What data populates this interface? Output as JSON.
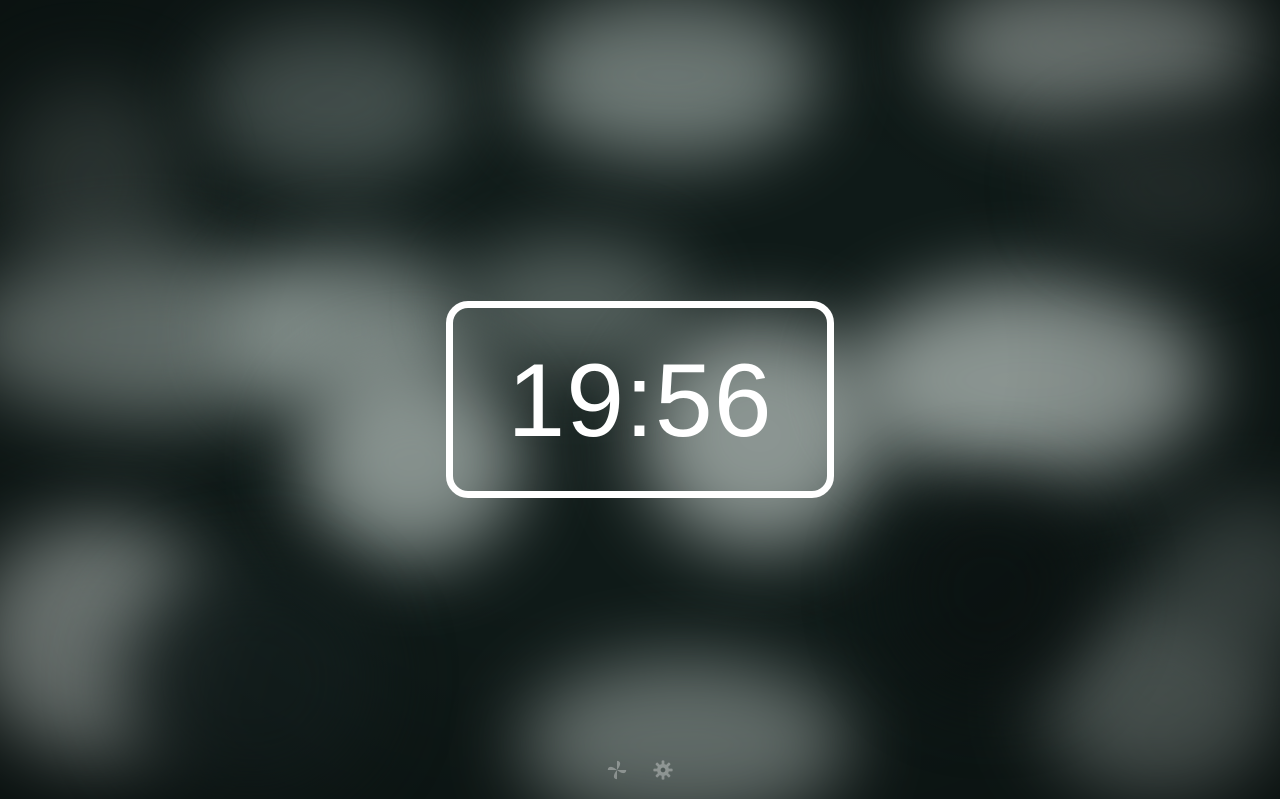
{
  "clock": {
    "time": "19:56"
  },
  "toolbar": {
    "items": [
      {
        "icon": "pinwheel-icon",
        "role": "background"
      },
      {
        "icon": "gear-icon",
        "role": "settings"
      }
    ]
  },
  "colors": {
    "background": "#0f1a18",
    "frame": "#ffffff",
    "text": "#ffffff",
    "bokeh_light": "#9aa7a3"
  }
}
